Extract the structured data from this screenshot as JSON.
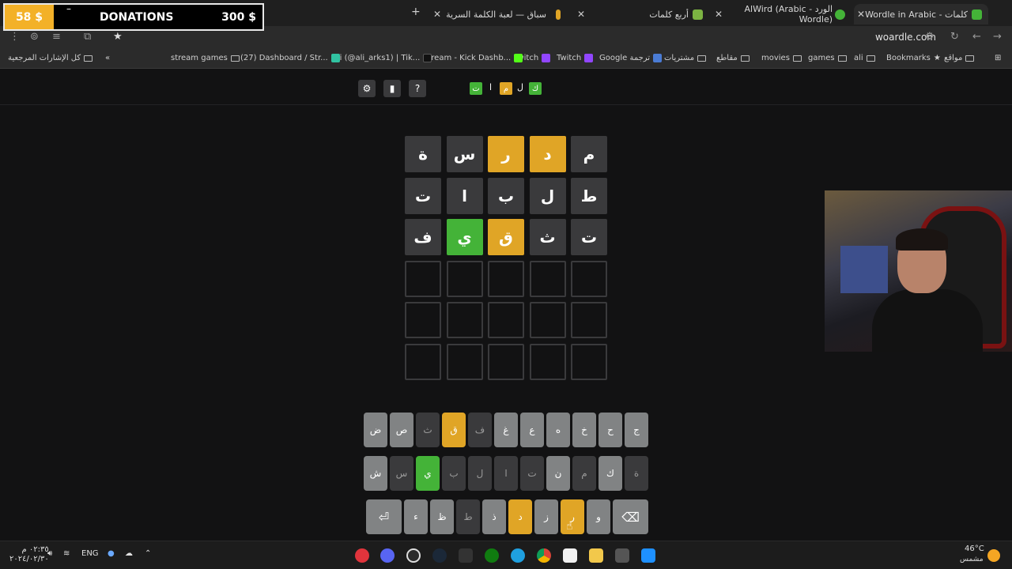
{
  "donations": {
    "current": "58 $",
    "title": "DONATIONS",
    "goal": "300 $"
  },
  "tabs": [
    {
      "title": "كلمات - Wordle in Arabic",
      "favicon_color": "#44b338"
    },
    {
      "title": "الورد - AlWird (Arabic Wordle)",
      "favicon_color": "#44b338"
    },
    {
      "title": "أربع كلمات",
      "favicon_color": "#7cb342"
    },
    {
      "title": "سباق — لعبة الكلمة السرية",
      "favicon_color": "#e0a526"
    }
  ],
  "address": {
    "url": "woardle.com"
  },
  "bookmarks": [
    "مواقع",
    "Bookmarks",
    "ali",
    "games",
    "movies",
    "مقاطع",
    "مشتريات",
    "Google ترجمة",
    "Twitch",
    "Twitch",
    "Stream - Kick Dashb...",
    "Ali (@ali_arks1) | Tik...",
    "(27) Dashboard / Str...",
    "stream games",
    "كل الإشارات المرجعية"
  ],
  "header": {
    "settings_icon": "gear-icon",
    "stats_icon": "bar-chart-icon",
    "help_label": "?",
    "logo": [
      {
        "ch": "ك",
        "state": "correct"
      },
      {
        "ch": "ل",
        "state": "none"
      },
      {
        "ch": "م",
        "state": "present"
      },
      {
        "ch": "ا",
        "state": "none"
      },
      {
        "ch": "ت",
        "state": "correct"
      }
    ]
  },
  "board": {
    "rows": [
      [
        {
          "ch": "م",
          "state": "absent"
        },
        {
          "ch": "د",
          "state": "present"
        },
        {
          "ch": "ر",
          "state": "present"
        },
        {
          "ch": "س",
          "state": "absent"
        },
        {
          "ch": "ة",
          "state": "absent"
        }
      ],
      [
        {
          "ch": "ط",
          "state": "absent"
        },
        {
          "ch": "ل",
          "state": "absent"
        },
        {
          "ch": "ب",
          "state": "absent"
        },
        {
          "ch": "ا",
          "state": "absent"
        },
        {
          "ch": "ت",
          "state": "absent"
        }
      ],
      [
        {
          "ch": "ت",
          "state": "absent"
        },
        {
          "ch": "ث",
          "state": "absent"
        },
        {
          "ch": "ق",
          "state": "present"
        },
        {
          "ch": "ي",
          "state": "correct"
        },
        {
          "ch": "ف",
          "state": "absent"
        }
      ],
      [
        {
          "ch": "",
          "state": "empty"
        },
        {
          "ch": "",
          "state": "empty"
        },
        {
          "ch": "",
          "state": "empty"
        },
        {
          "ch": "",
          "state": "empty"
        },
        {
          "ch": "",
          "state": "empty"
        }
      ],
      [
        {
          "ch": "",
          "state": "empty"
        },
        {
          "ch": "",
          "state": "empty"
        },
        {
          "ch": "",
          "state": "empty"
        },
        {
          "ch": "",
          "state": "empty"
        },
        {
          "ch": "",
          "state": "empty"
        }
      ],
      [
        {
          "ch": "",
          "state": "empty"
        },
        {
          "ch": "",
          "state": "empty"
        },
        {
          "ch": "",
          "state": "empty"
        },
        {
          "ch": "",
          "state": "empty"
        },
        {
          "ch": "",
          "state": "empty"
        }
      ]
    ]
  },
  "keyboard": {
    "rows": [
      [
        {
          "ch": "ج",
          "state": "unused"
        },
        {
          "ch": "ح",
          "state": "unused"
        },
        {
          "ch": "خ",
          "state": "unused"
        },
        {
          "ch": "ه",
          "state": "unused"
        },
        {
          "ch": "ع",
          "state": "unused"
        },
        {
          "ch": "غ",
          "state": "unused"
        },
        {
          "ch": "ف",
          "state": "absent"
        },
        {
          "ch": "ق",
          "state": "present"
        },
        {
          "ch": "ث",
          "state": "absent"
        },
        {
          "ch": "ص",
          "state": "unused"
        },
        {
          "ch": "ض",
          "state": "unused"
        }
      ],
      [
        {
          "ch": "ة",
          "state": "absent"
        },
        {
          "ch": "ك",
          "state": "unused"
        },
        {
          "ch": "م",
          "state": "absent"
        },
        {
          "ch": "ن",
          "state": "unused"
        },
        {
          "ch": "ت",
          "state": "absent"
        },
        {
          "ch": "ا",
          "state": "absent"
        },
        {
          "ch": "ل",
          "state": "absent"
        },
        {
          "ch": "ب",
          "state": "absent"
        },
        {
          "ch": "ي",
          "state": "correct"
        },
        {
          "ch": "س",
          "state": "absent"
        },
        {
          "ch": "ش",
          "state": "unused"
        }
      ],
      [
        {
          "ch": "⌫",
          "state": "unused"
        },
        {
          "ch": "و",
          "state": "unused"
        },
        {
          "ch": "ر",
          "state": "present"
        },
        {
          "ch": "ز",
          "state": "unused"
        },
        {
          "ch": "د",
          "state": "present"
        },
        {
          "ch": "ذ",
          "state": "unused"
        },
        {
          "ch": "ط",
          "state": "absent"
        },
        {
          "ch": "ظ",
          "state": "unused"
        },
        {
          "ch": "ء",
          "state": "unused"
        },
        {
          "ch": "⏎",
          "state": "unused"
        }
      ]
    ]
  },
  "taskbar": {
    "weather_temp": "46°C",
    "weather_desc": "مشمس",
    "language": "ENG",
    "time": "٠٢:٣٥ م",
    "date": "٢٠٢٤/٠٢/٣٠"
  },
  "colors": {
    "correct": "#44b338",
    "present": "#e0a526",
    "absent": "#3a3a3c",
    "unused": "#818384"
  }
}
